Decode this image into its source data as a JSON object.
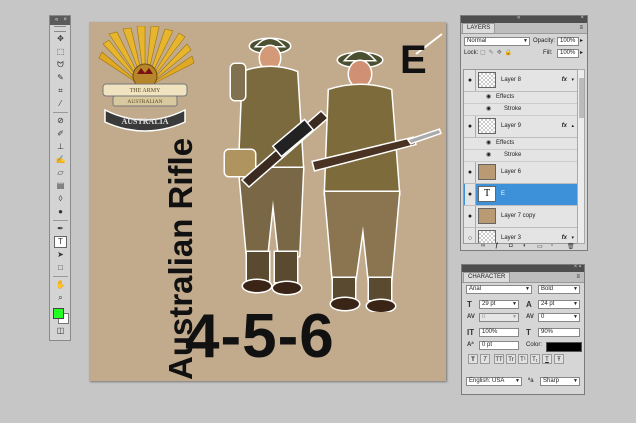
{
  "colors": {
    "foreground": "#23ff23",
    "background": "#ffffff",
    "canvas_bg": "#c2aa8c",
    "selected_layer": "#3d91d8",
    "text_color": "#000000"
  },
  "tools_panel": {
    "header": "«",
    "close": "×",
    "tools": [
      "move-tool-icon",
      "marquee-tool-icon",
      "lasso-tool-icon",
      "quick-select-icon",
      "crop-tool-icon",
      "eyedropper-icon",
      "spot-heal-icon",
      "brush-tool-icon",
      "clone-stamp-icon",
      "history-brush-icon",
      "eraser-icon",
      "gradient-icon",
      "blur-icon",
      "dodge-icon",
      "pen-tool-icon",
      "type-tool-icon",
      "path-select-icon",
      "shape-tool-icon",
      "hand-tool-icon",
      "zoom-tool-icon"
    ]
  },
  "canvas": {
    "vertical_text": "Australian Rifle",
    "big_text": "4-5-6",
    "corner_letter": "E",
    "badge": {
      "top_text": "THE ARMY",
      "middle_text": "AUSTRALIAN",
      "scroll_text": "AUSTRALIA"
    }
  },
  "layers_panel": {
    "tab": "LAYERS",
    "collapse": "«",
    "close": "×",
    "menu_icon": "≡",
    "blend_mode": "Normal",
    "opacity_label": "Opacity:",
    "opacity_value": "100%",
    "lock_label": "Lock:",
    "fill_label": "Fill:",
    "fill_value": "100%",
    "layers": [
      {
        "name": "Layer 8",
        "fx": "fx",
        "effects_label": "Effects",
        "effect": "Stroke"
      },
      {
        "name": "Layer 9",
        "fx": "fx",
        "effects_label": "Effects",
        "effect": "Stroke"
      },
      {
        "name": "Layer 6"
      },
      {
        "name": "E",
        "thumb": "T"
      },
      {
        "name": "Layer 7 copy"
      },
      {
        "name": "Layer 3",
        "fx": "fx"
      }
    ]
  },
  "character_panel": {
    "tab": "CHARACTER",
    "font_family": "Arial",
    "font_style": "Bold",
    "font_size": "29 pt",
    "leading": "24 pt",
    "kerning": "0",
    "tracking": "0",
    "vertical_scale": "100%",
    "horizontal_scale": "90%",
    "baseline_shift": "0 pt",
    "color_label": "Color:",
    "style_buttons": [
      "T",
      "T",
      "TT",
      "Tr",
      "T¹",
      "T₁",
      "T",
      "Ŧ"
    ],
    "language": "English: USA",
    "aa_label": "ªa",
    "antialias": "Sharp"
  }
}
